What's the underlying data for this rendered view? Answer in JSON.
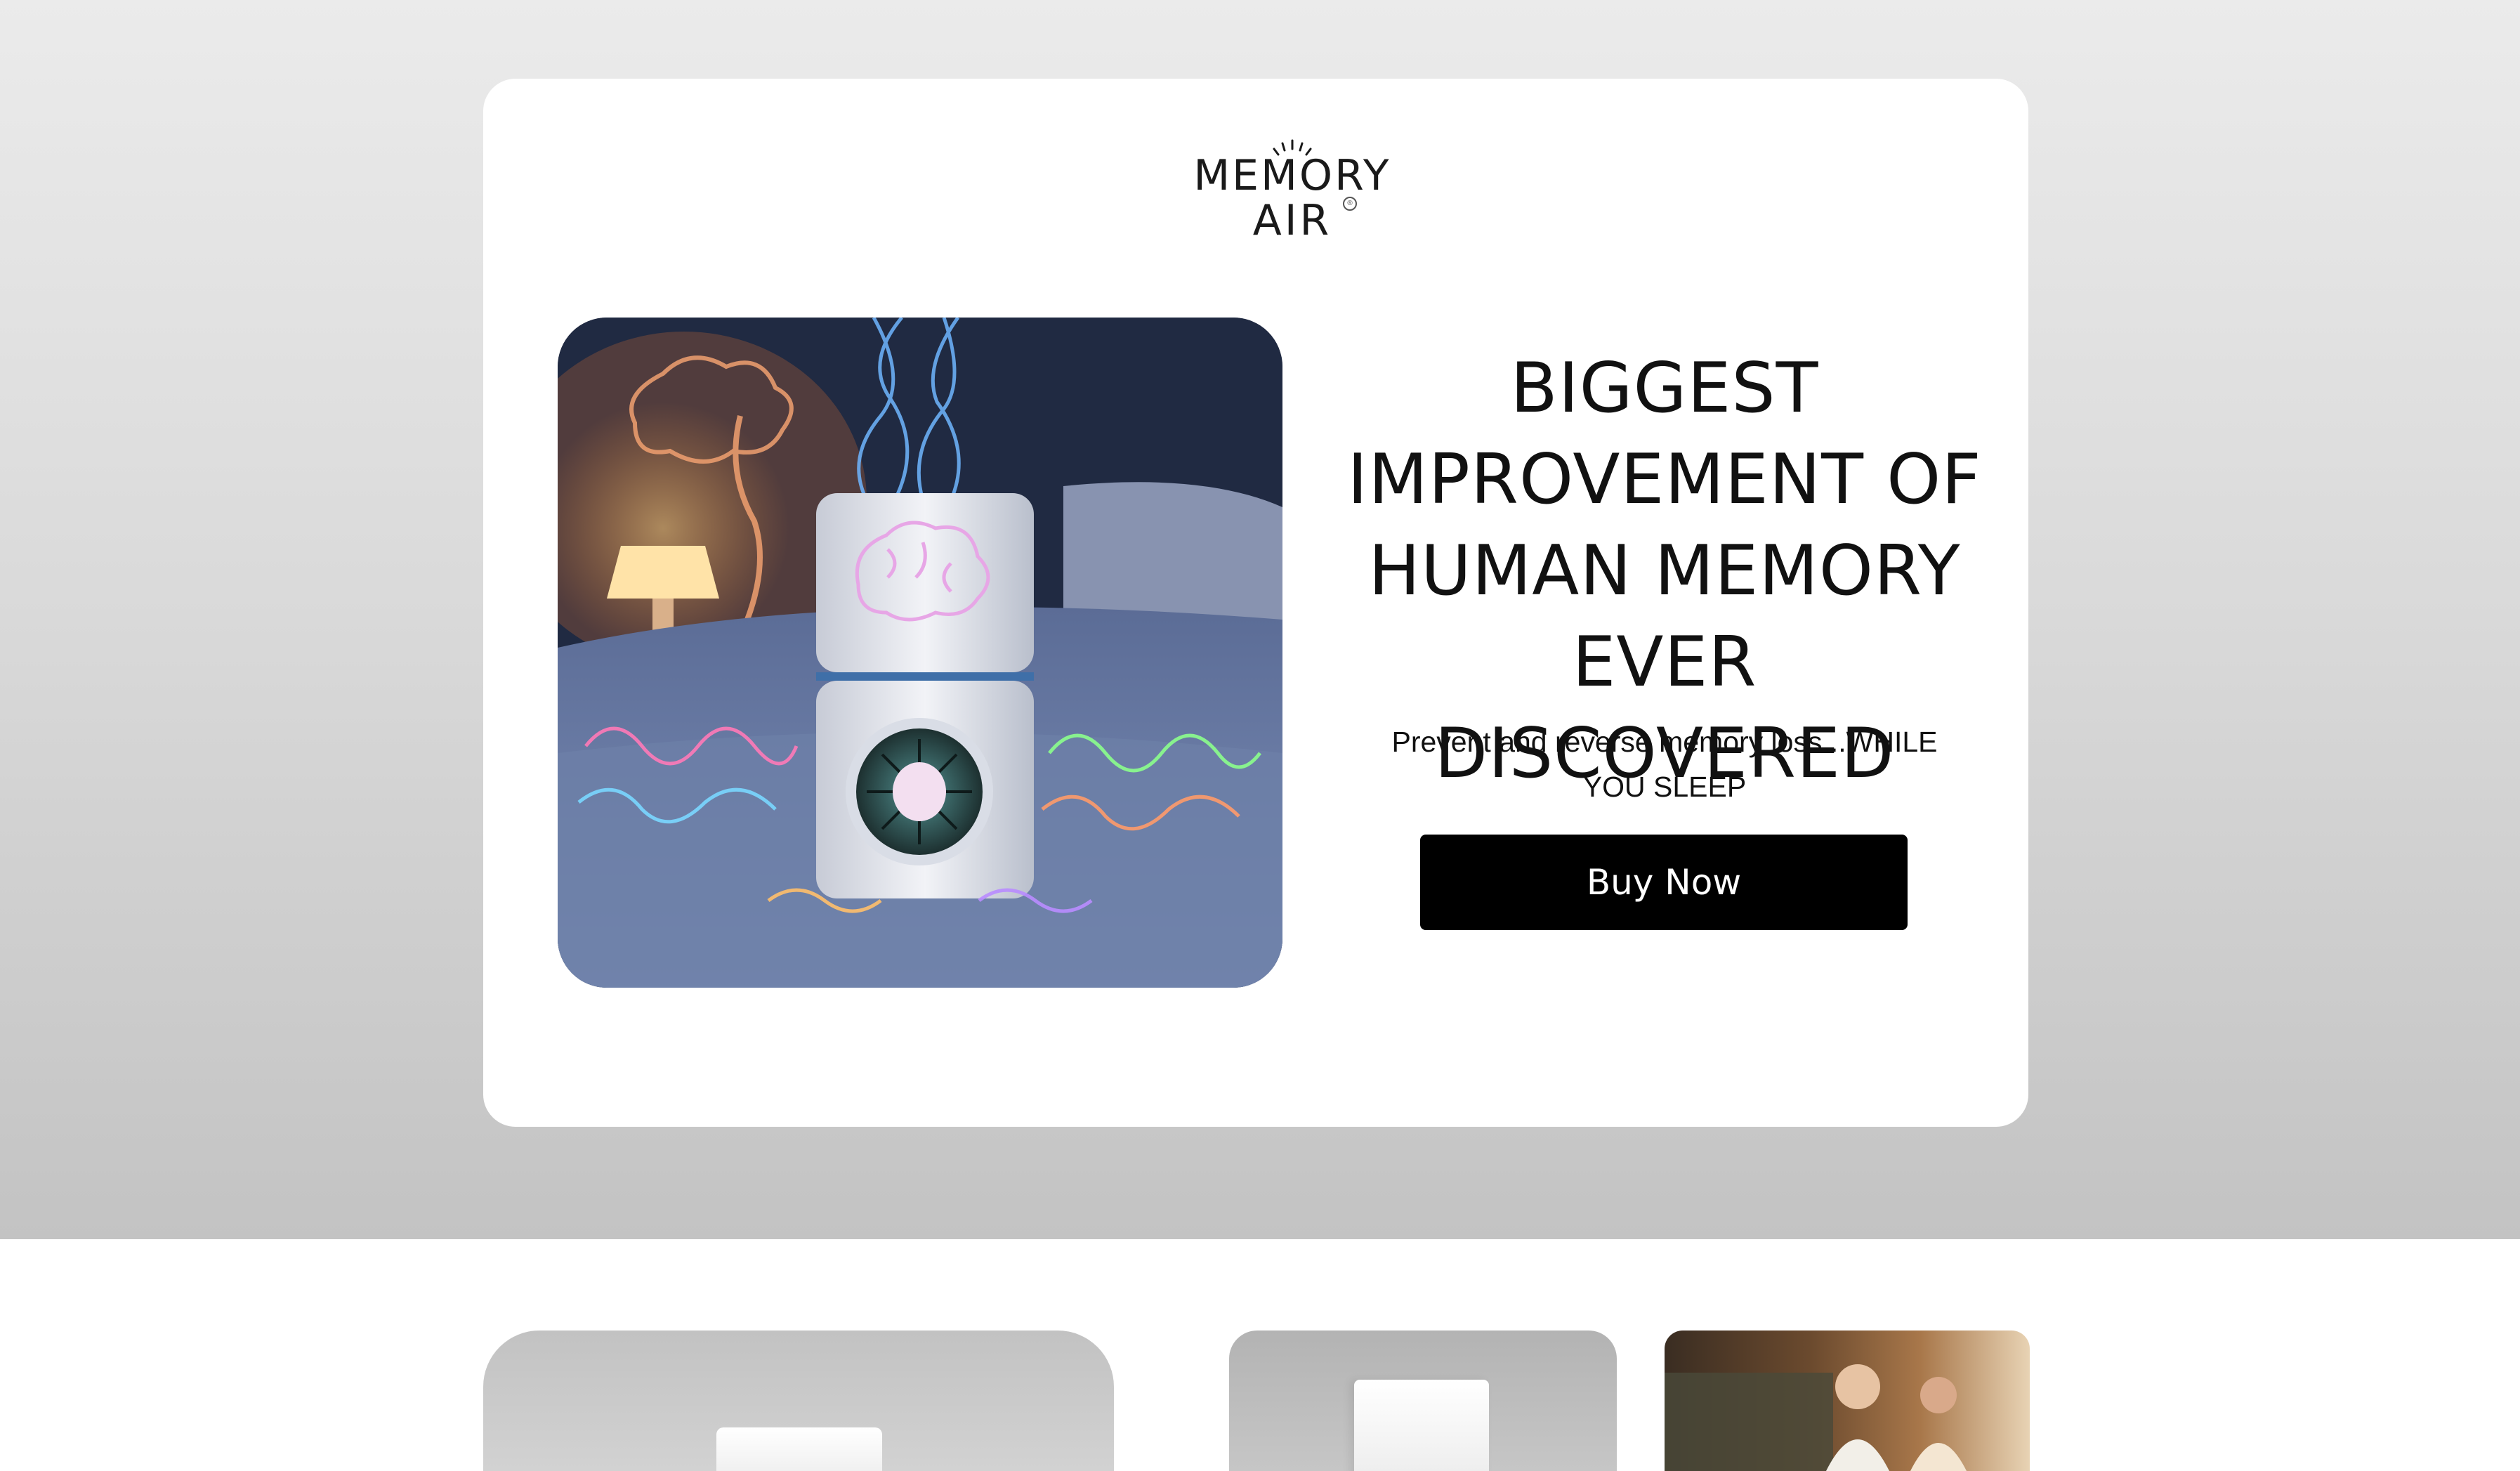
{
  "logo": {
    "line1": "MEMORY",
    "line2": "AIR",
    "registered": "®"
  },
  "hero": {
    "headline": "BIGGEST IMPROVEMENT OF HUMAN MEMORY EVER DISCOVERED",
    "subheadline": "Prevent and reverse memory loss...WHILE YOU SLEEP",
    "cta_label": "Buy Now",
    "image_alt": "Glowing air device on a bed with brain illustration"
  },
  "colors": {
    "cta_background": "#000000",
    "cta_text": "#ffffff",
    "page_background_top": "#ebebeb",
    "page_background_bottom": "#c3c3c3"
  },
  "gallery": {
    "items": [
      {
        "name": "product-photo-gray-background"
      },
      {
        "name": "product-photo-close-up"
      },
      {
        "name": "elderly-couple-bedroom-photo"
      }
    ]
  }
}
